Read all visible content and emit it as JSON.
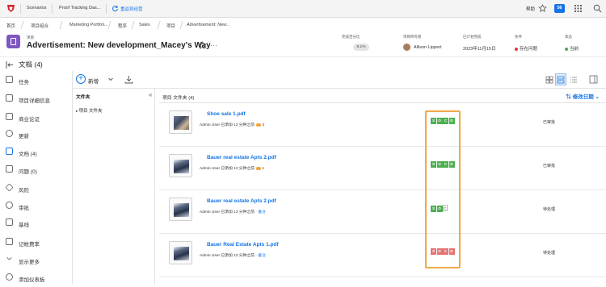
{
  "topbar": {
    "tabs": [
      "Scenarios",
      "Proof Tracking Das..."
    ],
    "switch_label": "重返到经营",
    "help_label": "帮助",
    "notification_count": "56"
  },
  "breadcrumbs": [
    "首页",
    "项目组合",
    "Marketing Portfoli...",
    "程序",
    "Sales",
    "项目",
    "Advertisement: New..."
  ],
  "project": {
    "type": "项目",
    "title": "Advertisement: New development_Macey's Way",
    "cols": {
      "percent_label": "完成百分比",
      "percent_value": "6.1%",
      "owner_label": "项目所有者",
      "owner_value": "Allison Lippert",
      "planned_label": "已计划完成",
      "planned_value": "2023年11月15日",
      "condition_label": "条件",
      "condition_value": "存在问题",
      "status_label": "状态",
      "status_value": "当前"
    },
    "colors": {
      "brand": "#7e57c2",
      "accent": "#1473e6",
      "issue": "#e53935",
      "current": "#4caf50"
    }
  },
  "subhead": {
    "title": "文档 (4)"
  },
  "sidebar": {
    "items": [
      {
        "label": "任务",
        "icon": "tasks-icon"
      },
      {
        "label": "项目详细信息",
        "icon": "details-icon"
      },
      {
        "label": "商业论证",
        "icon": "business-case-icon"
      },
      {
        "label": "更新",
        "icon": "updates-icon"
      },
      {
        "label": "文档 (4)",
        "icon": "documents-icon"
      },
      {
        "label": "问题 (0)",
        "icon": "issues-icon"
      },
      {
        "label": "风险",
        "icon": "risk-icon"
      },
      {
        "label": "审批",
        "icon": "approvals-icon"
      },
      {
        "label": "基线",
        "icon": "baselines-icon"
      },
      {
        "label": "记帐费率",
        "icon": "billing-icon"
      },
      {
        "label": "显示更多",
        "icon": "more-icon"
      },
      {
        "label": "添加仪表板",
        "icon": "add-dashboard-icon"
      }
    ]
  },
  "toolbar": {
    "new_label": "新增"
  },
  "folders": {
    "heading": "文件夹",
    "item": "项目 文件夹"
  },
  "list": {
    "heading": "项目 文件夹 (4)",
    "sort_label": "修改日期"
  },
  "documents": [
    {
      "name": "Shoe sale 1.pdf",
      "meta": "Admin User 已添加 12 分钟之前",
      "badge": "3",
      "note": "",
      "proof": [
        "S",
        "O",
        "C",
        "D"
      ],
      "proof_colors": [
        "g",
        "g",
        "g",
        "g"
      ],
      "status": "已审批"
    },
    {
      "name": "Bauer real estate Apts 2.pdf",
      "meta": "Admin User 已添加 13 分钟之前",
      "badge": "1",
      "note": "",
      "proof": [
        "S",
        "O",
        "C",
        "D"
      ],
      "proof_colors": [
        "g",
        "g",
        "g",
        "g"
      ],
      "status": "已审批"
    },
    {
      "name": "Bauer real estate Apts 2.pdf",
      "meta": "Admin User 已添加 13 分钟之前 ·",
      "badge": "",
      "note": "备注",
      "proof": [
        "S",
        "O",
        "C"
      ],
      "proof_colors": [
        "g",
        "g",
        "gr"
      ],
      "status": "待处理"
    },
    {
      "name": "Bauer Real Estate Apts 1.pdf",
      "meta": "Admin User 已添加 13 分钟之前 ·",
      "badge": "",
      "note": "备注",
      "proof": [
        "S",
        "O",
        "C",
        "D"
      ],
      "proof_colors": [
        "r",
        "r",
        "r",
        "r"
      ],
      "status": "待处理"
    }
  ]
}
